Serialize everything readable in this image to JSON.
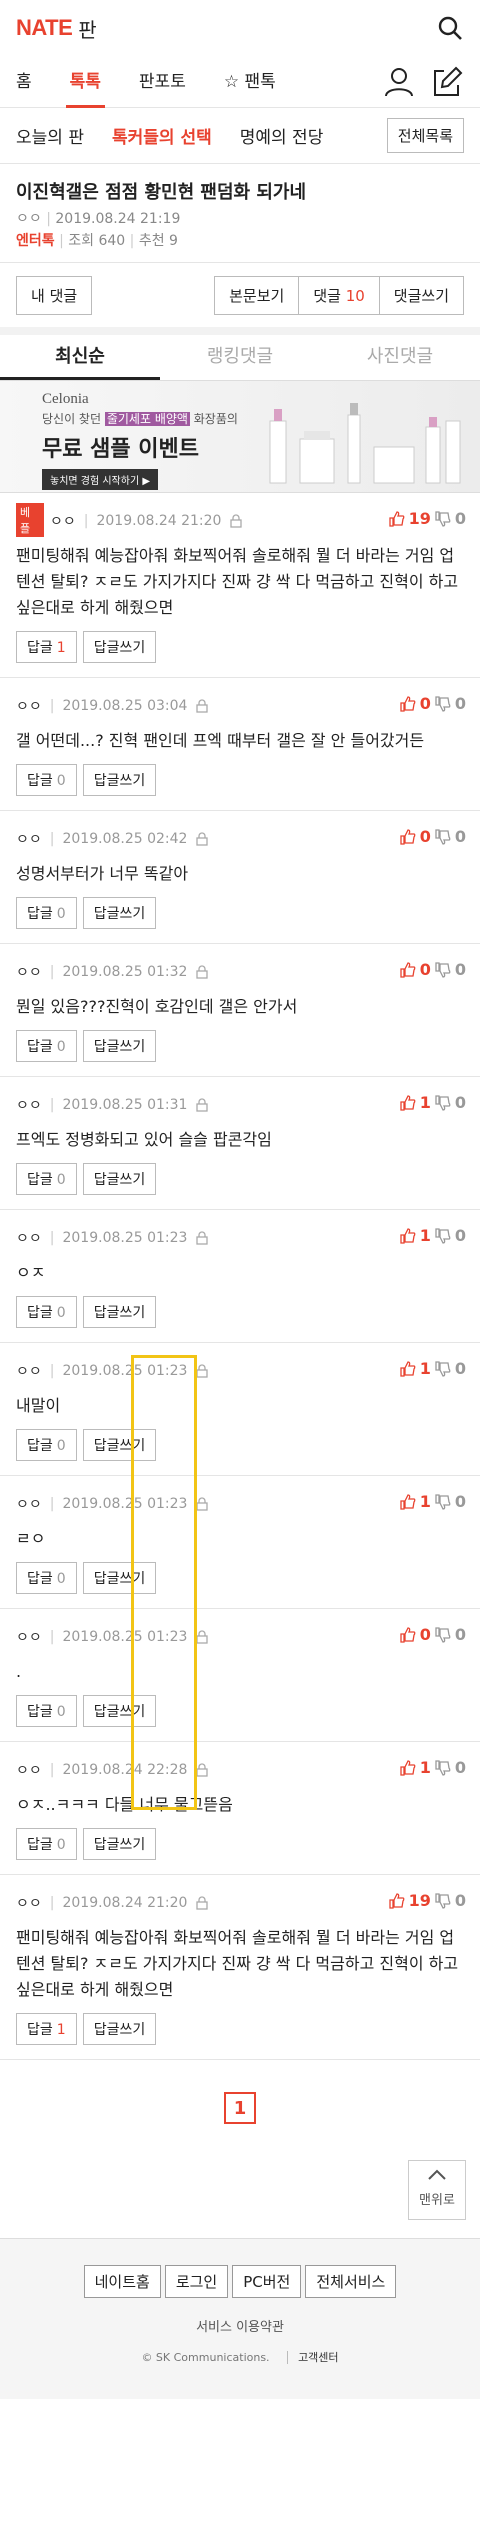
{
  "header": {
    "logo": "NATE",
    "section": "판"
  },
  "gnb": {
    "tabs": [
      "홈",
      "톡톡",
      "판포토",
      "☆ 팬톡"
    ]
  },
  "subnav": {
    "items": [
      "오늘의 판",
      "톡커들의 선택",
      "명예의 전당"
    ],
    "full_list": "전체목록"
  },
  "post": {
    "title": "이진혁갤은 점점 황민현 팬덤화 되가네",
    "author": "ㅇㅇ",
    "datetime": "2019.08.24 21:19",
    "category": "엔터톡",
    "views": "조회 640",
    "recommend": "추천 9"
  },
  "buttons": {
    "my_comments": "내 댓글",
    "view_post": "본문보기",
    "comments_label": "댓글",
    "comments_count": "10",
    "write_comment": "댓글쓰기"
  },
  "sort_tabs": [
    "최신순",
    "랭킹댓글",
    "사진댓글"
  ],
  "banner": {
    "brand": "Celonia",
    "sub_prefix": "당신이 찾던 ",
    "sub_highlight": "줄기세포 배양액",
    "sub_suffix": " 화장품의",
    "headline": "무료 샘플 이벤트",
    "cta": "놓치면 경험 시작하기 ▶"
  },
  "reply_label": "답글",
  "write_reply_label": "답글쓰기",
  "best_label": "베플",
  "comments": [
    {
      "best": true,
      "author": "ㅇㅇ",
      "date": "2019.08.24 21:20",
      "up": "19",
      "down": "0",
      "body": "팬미팅해줘 예능잡아줘 화보찍어줘 솔로해줘 뭘 더 바라는 거임 업텐션 탈퇴? ㅈㄹ도 가지가지다 진짜 걍 싹 다 먹금하고 진혁이 하고싶은대로 하게 해줬으면",
      "replies": "1"
    },
    {
      "best": false,
      "author": "ㅇㅇ",
      "date": "2019.08.25 03:04",
      "up": "0",
      "down": "0",
      "body": "갤 어떤데...? 진혁 팬인데 프엑 때부터 갤은 잘 안 들어갔거든",
      "replies": "0"
    },
    {
      "best": false,
      "author": "ㅇㅇ",
      "date": "2019.08.25 02:42",
      "up": "0",
      "down": "0",
      "body": "성명서부터가 너무 똑같아",
      "replies": "0"
    },
    {
      "best": false,
      "author": "ㅇㅇ",
      "date": "2019.08.25 01:32",
      "up": "0",
      "down": "0",
      "body": "뭔일 있음???진혁이 호감인데 갤은 안가서",
      "replies": "0"
    },
    {
      "best": false,
      "author": "ㅇㅇ",
      "date": "2019.08.25 01:31",
      "up": "1",
      "down": "0",
      "body": "프엑도 정병화되고 있어 슬슬 팝콘각임",
      "replies": "0"
    },
    {
      "best": false,
      "author": "ㅇㅇ",
      "date": "2019.08.25 01:23",
      "up": "1",
      "down": "0",
      "body": "ㅇㅈ",
      "replies": "0"
    },
    {
      "best": false,
      "author": "ㅇㅇ",
      "date": "2019.08.25 01:23",
      "up": "1",
      "down": "0",
      "body": "내말이",
      "replies": "0"
    },
    {
      "best": false,
      "author": "ㅇㅇ",
      "date": "2019.08.25 01:23",
      "up": "1",
      "down": "0",
      "body": "ㄹㅇ",
      "replies": "0"
    },
    {
      "best": false,
      "author": "ㅇㅇ",
      "date": "2019.08.25 01:23",
      "up": "0",
      "down": "0",
      "body": ".",
      "replies": "0"
    },
    {
      "best": false,
      "author": "ㅇㅇ",
      "date": "2019.08.24 22:28",
      "up": "1",
      "down": "0",
      "body": "ㅇㅈ..ㅋㅋㅋ 다들 너무 물고뜯음",
      "replies": "0"
    },
    {
      "best": false,
      "author": "ㅇㅇ",
      "date": "2019.08.24 21:20",
      "up": "19",
      "down": "0",
      "body": "팬미팅해줘 예능잡아줘 화보찍어줘 솔로해줘 뭘 더 바라는 거임 업텐션 탈퇴? ㅈㄹ도 가지가지다 진짜 걍 싹 다 먹금하고 진혁이 하고싶은대로 하게 해줬으면",
      "replies": "1"
    }
  ],
  "pager": {
    "current": "1"
  },
  "to_top": "맨위로",
  "footer": {
    "buttons": [
      "네이트홈",
      "로그인",
      "PC버전",
      "전체서비스"
    ],
    "terms": "서비스 이용약관",
    "copyright": "© SK Communications.",
    "customer_center": "고객센터"
  },
  "colors": {
    "accent": "#e8422f",
    "highlight": "#f2c415"
  }
}
